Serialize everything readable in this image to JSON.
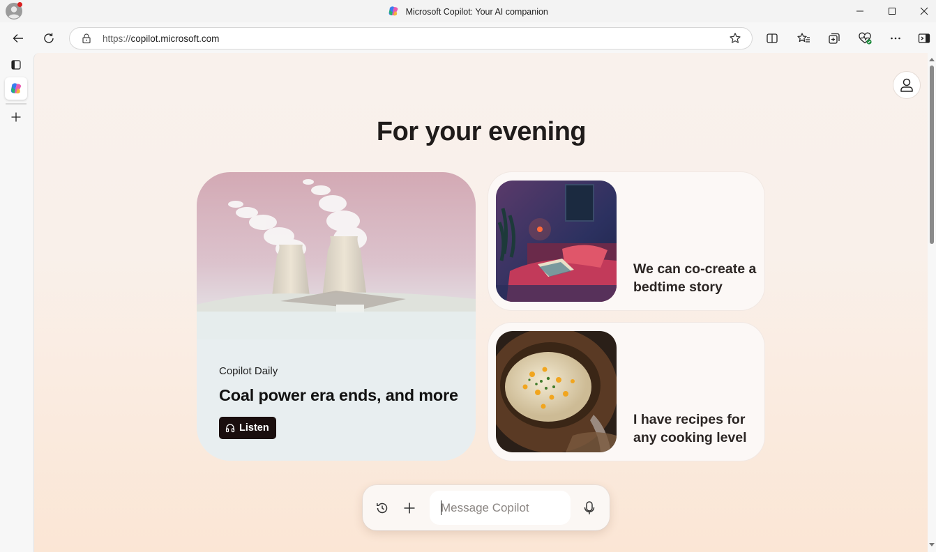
{
  "window": {
    "title": "Microsoft Copilot: Your AI companion",
    "controls": [
      "minimize",
      "maximize",
      "close"
    ]
  },
  "browser": {
    "url_scheme": "https://",
    "url_host": "copilot.microsoft.com",
    "toolbar_icons": [
      "back-icon",
      "refresh-icon",
      "lock-icon",
      "favorite-star-icon",
      "split-screen-icon",
      "favorites-icon",
      "collections-icon",
      "browser-essentials-icon",
      "more-icon",
      "sidebar-icon"
    ]
  },
  "sidebar": {
    "items": [
      "tab-actions-icon",
      "copilot-tab",
      "new-tab-icon"
    ]
  },
  "page": {
    "heading": "For your evening",
    "daily_card": {
      "label": "Copilot Daily",
      "title": "Coal power era ends, and more",
      "listen_label": "Listen"
    },
    "suggestion_cards": [
      {
        "caption": "We can co-create a bedtime story"
      },
      {
        "caption": "I have recipes for any cooking level"
      }
    ],
    "composer": {
      "placeholder": "Message Copilot"
    }
  },
  "colors": {
    "accent_dark": "#1a0e0e",
    "background_top": "#f9f1ec",
    "background_bottom": "#fbe6d5"
  }
}
